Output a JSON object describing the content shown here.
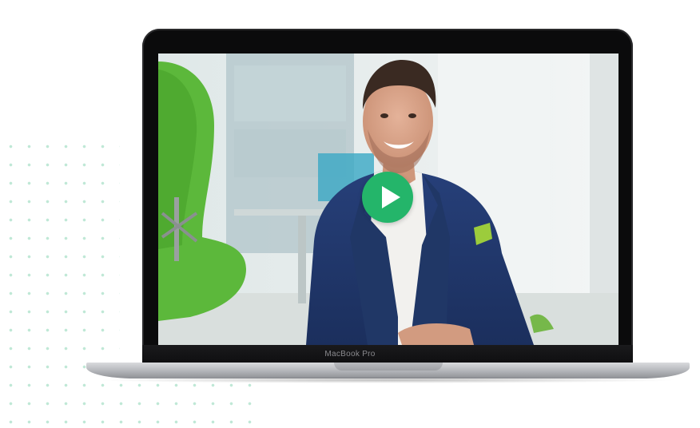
{
  "laptop": {
    "brand_label": "MacBook Pro"
  },
  "video": {
    "play_icon": "play-icon",
    "accent_color": "#24b56a"
  }
}
